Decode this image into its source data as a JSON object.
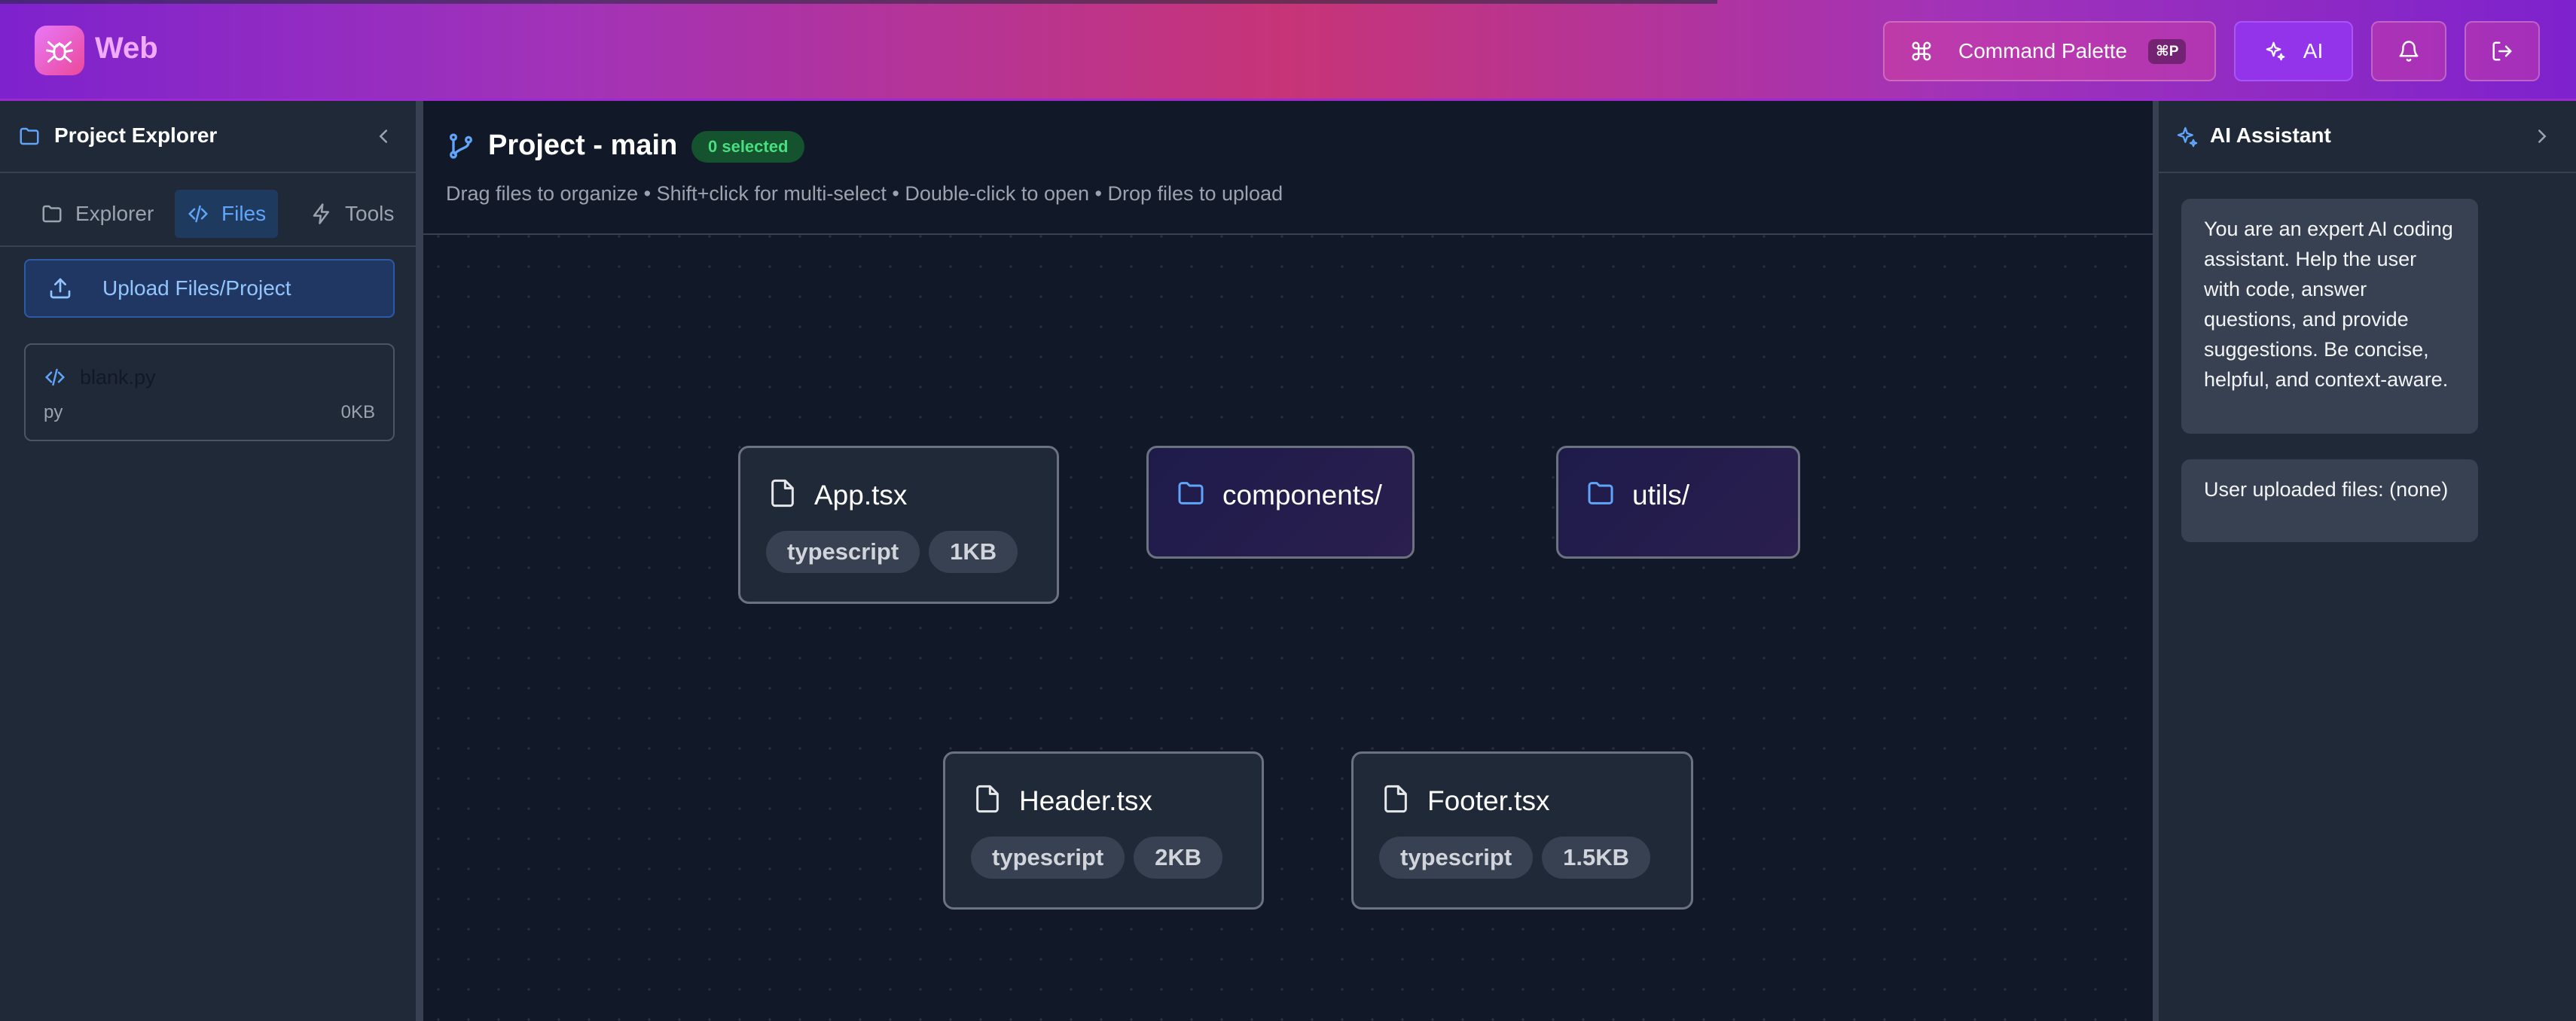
{
  "header": {
    "app_name": "Web",
    "command_palette_label": "Command Palette",
    "command_shortcut": "⌘P",
    "ai_label": "AI"
  },
  "sidebar": {
    "title": "Project Explorer",
    "tabs": [
      {
        "label": "Explorer",
        "active": false
      },
      {
        "label": "Files",
        "active": true
      },
      {
        "label": "Tools",
        "active": false
      }
    ],
    "upload_label": "Upload Files/Project",
    "files": [
      {
        "name": "blank.py",
        "ext": "py",
        "size": "0KB"
      }
    ]
  },
  "main": {
    "title": "Project - main",
    "selected_badge": "0 selected",
    "hint": "Drag files to organize • Shift+click for multi-select • Double-click to open • Drop files to upload",
    "nodes": [
      {
        "name": "App.tsx",
        "kind": "file",
        "lang": "typescript",
        "size": "1KB"
      },
      {
        "name": "components/",
        "kind": "folder"
      },
      {
        "name": "utils/",
        "kind": "folder"
      },
      {
        "name": "Header.tsx",
        "kind": "file",
        "lang": "typescript",
        "size": "2KB"
      },
      {
        "name": "Footer.tsx",
        "kind": "file",
        "lang": "typescript",
        "size": "1.5KB"
      }
    ]
  },
  "ai_panel": {
    "title": "AI Assistant",
    "messages": [
      {
        "text": "You are an expert AI coding assistant. Help the user with code, answer questions, and provide suggestions. Be concise, helpful, and context-aware."
      },
      {
        "text": "User uploaded files: (none)"
      }
    ]
  },
  "colors": {
    "accent_purple": "#9333ea",
    "accent_pink": "#ec4899",
    "active_tab_blue": "#60a5fa",
    "success_green": "#4ade80",
    "background": "#111827"
  },
  "icons": [
    "spider-logo-icon",
    "command-icon",
    "sparkles-icon",
    "bell-icon",
    "logout-icon",
    "folder-icon",
    "chevron-left-icon",
    "code-icon",
    "bolt-icon",
    "upload-icon",
    "git-branch-icon",
    "file-icon",
    "chevron-right-icon"
  ]
}
